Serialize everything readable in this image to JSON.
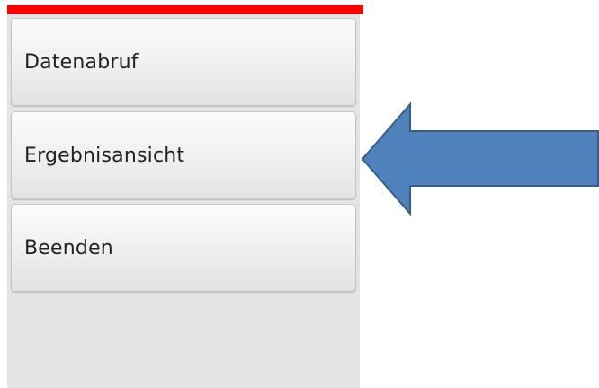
{
  "menu": {
    "items": [
      {
        "label": "Datenabruf"
      },
      {
        "label": "Ergebnisansicht"
      },
      {
        "label": "Beenden"
      }
    ]
  },
  "colors": {
    "accent_bar": "#ff0000",
    "panel_background": "#e4e4e4",
    "arrow_fill": "#4f81bd",
    "arrow_stroke": "#385d8a"
  },
  "annotation": {
    "icon": "arrow-left-icon",
    "points_to": "Ergebnisansicht"
  }
}
